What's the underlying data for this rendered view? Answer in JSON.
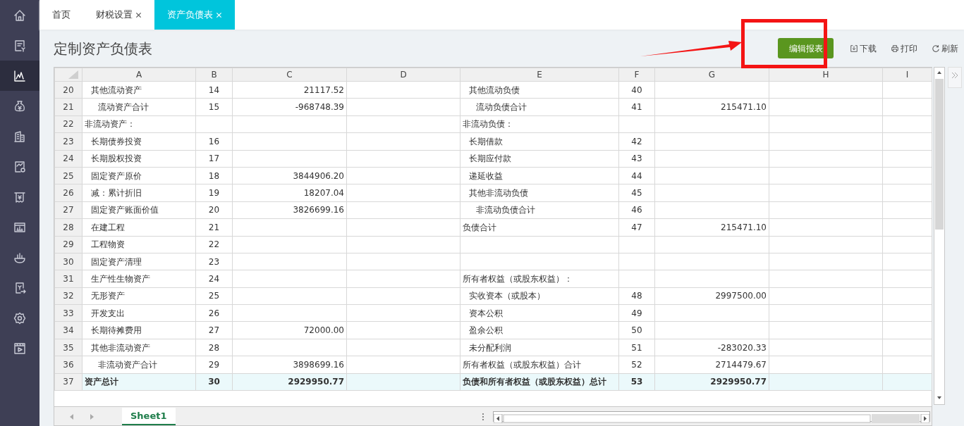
{
  "sidebar": {
    "items": [
      {
        "kind": "home",
        "selected": false
      },
      {
        "kind": "invoice",
        "selected": false
      },
      {
        "kind": "chart",
        "selected": true
      },
      {
        "kind": "moneybag",
        "selected": false
      },
      {
        "kind": "building",
        "selected": false
      },
      {
        "kind": "report",
        "selected": false
      },
      {
        "kind": "receipt",
        "selected": false
      },
      {
        "kind": "board",
        "selected": false
      },
      {
        "kind": "hand",
        "selected": false
      },
      {
        "kind": "export",
        "selected": false
      },
      {
        "kind": "settings",
        "selected": false
      },
      {
        "kind": "video",
        "selected": false
      }
    ]
  },
  "tabs": [
    {
      "label": "首页",
      "closable": false,
      "selected": false
    },
    {
      "label": "财税设置",
      "closable": true,
      "selected": false
    },
    {
      "label": "资产负债表",
      "closable": true,
      "selected": true
    }
  ],
  "page_title": "定制资产负债表",
  "primary_button": "编辑报表",
  "actions": [
    {
      "label": "下载",
      "kind": "download"
    },
    {
      "label": "打印",
      "kind": "print"
    },
    {
      "label": "刷新",
      "kind": "refresh"
    }
  ],
  "annotation": {
    "kind": "callout"
  },
  "sheet": {
    "columns": [
      "A",
      "B",
      "C",
      "D",
      "E",
      "F",
      "G",
      "H",
      "I"
    ],
    "rows": [
      {
        "row": "20",
        "total": false,
        "left": {
          "label": "其他流动资产",
          "kind": "item",
          "line": "14",
          "amount": "21117.52"
        },
        "right": {
          "label": "其他流动负债",
          "kind": "item",
          "line": "40"
        }
      },
      {
        "row": "21",
        "total": false,
        "left": {
          "label": "流动资产合计",
          "kind": "subtotal",
          "line": "15",
          "amount": "-968748.39"
        },
        "right": {
          "label": "流动负债合计",
          "kind": "subtotal",
          "line": "41",
          "amount": "215471.10"
        }
      },
      {
        "row": "22",
        "total": false,
        "left": {
          "label": "非流动资产：",
          "kind": "section"
        },
        "right": {
          "label": "非流动负债：",
          "kind": "section"
        }
      },
      {
        "row": "23",
        "total": false,
        "left": {
          "label": "长期债券投资",
          "kind": "item",
          "line": "16"
        },
        "right": {
          "label": "长期借款",
          "kind": "item",
          "line": "42"
        }
      },
      {
        "row": "24",
        "total": false,
        "left": {
          "label": "长期股权投资",
          "kind": "item",
          "line": "17"
        },
        "right": {
          "label": "长期应付款",
          "kind": "item",
          "line": "43"
        }
      },
      {
        "row": "25",
        "total": false,
        "left": {
          "label": "固定资产原价",
          "kind": "item",
          "line": "18",
          "amount": "3844906.20"
        },
        "right": {
          "label": "递延收益",
          "kind": "item",
          "line": "44"
        }
      },
      {
        "row": "26",
        "total": false,
        "left": {
          "label": "减：累计折旧",
          "kind": "item",
          "line": "19",
          "amount": "18207.04"
        },
        "right": {
          "label": "其他非流动负债",
          "kind": "item",
          "line": "45"
        }
      },
      {
        "row": "27",
        "total": false,
        "left": {
          "label": "固定资产账面价值",
          "kind": "item",
          "line": "20",
          "amount": "3826699.16"
        },
        "right": {
          "label": "非流动负债合计",
          "kind": "subtotal",
          "line": "46"
        }
      },
      {
        "row": "28",
        "total": false,
        "left": {
          "label": "在建工程",
          "kind": "item",
          "line": "21"
        },
        "right": {
          "label": "负债合计",
          "kind": "section",
          "line": "47",
          "amount": "215471.10"
        }
      },
      {
        "row": "29",
        "total": false,
        "left": {
          "label": "工程物资",
          "kind": "item",
          "line": "22"
        }
      },
      {
        "row": "30",
        "total": false,
        "left": {
          "label": "固定资产清理",
          "kind": "item",
          "line": "23"
        }
      },
      {
        "row": "31",
        "total": false,
        "left": {
          "label": "生产性生物资产",
          "kind": "item",
          "line": "24"
        },
        "right": {
          "label": "所有者权益（或股东权益）：",
          "kind": "section"
        }
      },
      {
        "row": "32",
        "total": false,
        "left": {
          "label": "无形资产",
          "kind": "item",
          "line": "25"
        },
        "right": {
          "label": "实收资本（或股本）",
          "kind": "item",
          "line": "48",
          "amount": "2997500.00"
        }
      },
      {
        "row": "33",
        "total": false,
        "left": {
          "label": "开发支出",
          "kind": "item",
          "line": "26"
        },
        "right": {
          "label": "资本公积",
          "kind": "item",
          "line": "49"
        }
      },
      {
        "row": "34",
        "total": false,
        "left": {
          "label": "长期待摊费用",
          "kind": "item",
          "line": "27",
          "amount": "72000.00"
        },
        "right": {
          "label": "盈余公积",
          "kind": "item",
          "line": "50"
        }
      },
      {
        "row": "35",
        "total": false,
        "left": {
          "label": "其他非流动资产",
          "kind": "item",
          "line": "28"
        },
        "right": {
          "label": "未分配利润",
          "kind": "item",
          "line": "51",
          "amount": "-283020.33"
        }
      },
      {
        "row": "36",
        "total": false,
        "left": {
          "label": "非流动资产合计",
          "kind": "subtotal",
          "line": "29",
          "amount": "3898699.16"
        },
        "right": {
          "label": "所有者权益（或股东权益）合计",
          "kind": "section",
          "line": "52",
          "amount": "2714479.67"
        }
      },
      {
        "row": "37",
        "total": true,
        "left": {
          "label": "资产总计",
          "kind": "section",
          "line": "30",
          "amount": "2929950.77"
        },
        "right": {
          "label": "负债和所有者权益（或股东权益）总计",
          "kind": "section",
          "line": "53",
          "amount": "2929950.77"
        }
      }
    ]
  },
  "sheet_tabs": [
    {
      "label": "Sheet1",
      "selected": true
    }
  ]
}
